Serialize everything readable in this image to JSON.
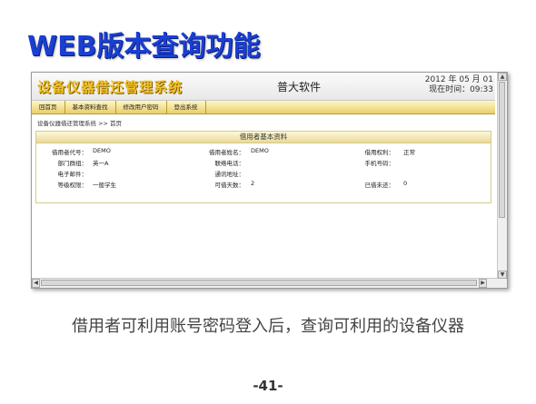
{
  "slide": {
    "title": "WEB版本查询功能",
    "caption": "借用者可利用账号密码登入后，查询可利用的设备仪器",
    "page_number": "-41-"
  },
  "app": {
    "logo": "设备仪器借还管理系统",
    "company": "普大软件",
    "date": "2012 年  05 月  01",
    "time": "现在时间：09:33"
  },
  "menu": {
    "items": [
      "回首页",
      "基本资料查找",
      "修改用户密码",
      "登出系统"
    ]
  },
  "breadcrumb": "设备仪器借还管理系统  >> 首页",
  "panel": {
    "title": "借用者基本资料",
    "fields": {
      "borrower_code_label": "借用者代号：",
      "borrower_code": "DEMO",
      "borrower_name_label": "借用者姓名：",
      "borrower_name": "DEMO",
      "borrow_right_label": "借用权利：",
      "borrow_right": "正常",
      "dept_label": "部门群组：",
      "dept": "英一A",
      "phone_label": "联络电话：",
      "phone": "",
      "mobile_label": "手机号码：",
      "mobile": "",
      "email_label": "电子邮件：",
      "email": "",
      "address_label": "通讯地址：",
      "address": "",
      "level_label": "等级权限：",
      "level": "一般学生",
      "days_label": "可借天数：",
      "days": "2",
      "unreturned_label": "已借未还：",
      "unreturned": "0"
    }
  },
  "colors": {
    "title_blue": "#1a3fd1",
    "menu_gold": "#e9cf6a",
    "logo_gold": "#f2c12a"
  },
  "icons": {
    "scroll_up": "scroll-up-arrow-icon",
    "scroll_down": "scroll-down-arrow-icon",
    "scroll_left": "scroll-left-arrow-icon",
    "scroll_right": "scroll-right-arrow-icon"
  }
}
